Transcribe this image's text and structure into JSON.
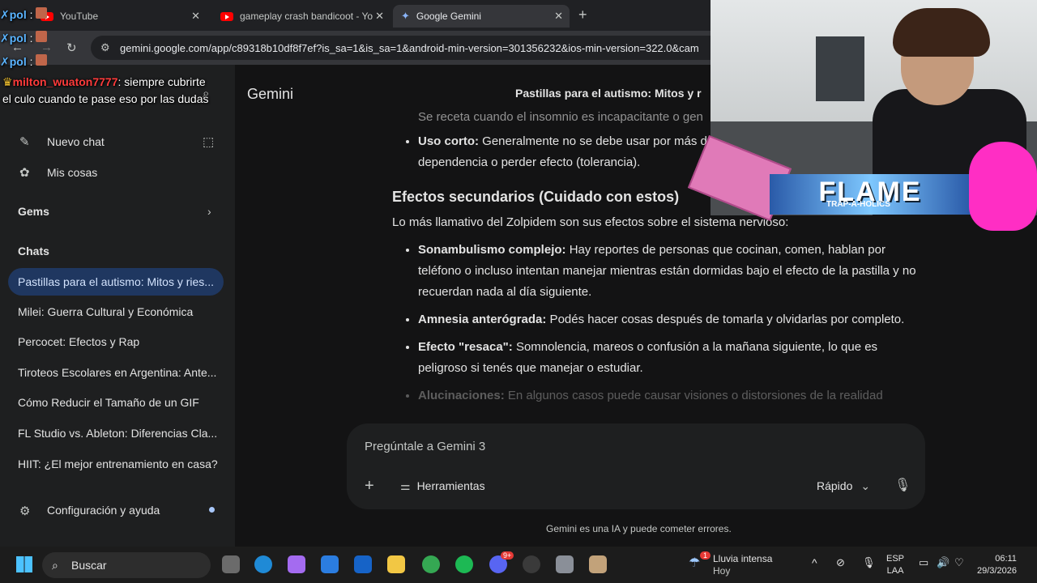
{
  "browser": {
    "tabs": [
      {
        "label": "YouTube"
      },
      {
        "label": "gameplay crash bandicoot - Yo"
      },
      {
        "label": "Google Gemini"
      }
    ],
    "url": "gemini.google.com/app/c89318b10df8f7ef?is_sa=1&is_sa=1&android-min-version=301356232&ios-min-version=322.0&cam"
  },
  "sidebar": {
    "new_chat": "Nuevo chat",
    "my_stuff": "Mis cosas",
    "gems": "Gems",
    "chats_heading": "Chats",
    "chats": [
      "Pastillas para el autismo: Mitos y ries...",
      "Milei: Guerra Cultural y Económica",
      "Percocet: Efectos y Rap",
      "Tiroteos Escolares en Argentina: Ante...",
      "Cómo Reducir el Tamaño de un GIF",
      "FL Studio vs. Ableton: Diferencias Cla...",
      "HIIT: ¿El mejor entrenamiento en casa?"
    ],
    "settings": "Configuración y ayuda"
  },
  "main": {
    "brand": "Gemini",
    "conversation_title": "Pastillas para el autismo: Mitos y r",
    "top_fragment": "Se receta cuando el insomnio es incapacitante o gen",
    "short_use_label": "Uso corto:",
    "short_use_text": " Generalmente no se debe usar por más d",
    "short_use_text2": "dependencia o perder efecto (tolerancia).",
    "section_heading": "Efectos secundarios (Cuidado con estos)",
    "intro": "Lo más llamativo del Zolpidem son sus efectos sobre el sistema nervioso:",
    "bullets": [
      {
        "label": "Sonambulismo complejo:",
        "text": " Hay reportes de personas que cocinan, comen, hablan por teléfono o incluso intentan manejar mientras están dormidas bajo el efecto de la pastilla y no recuerdan nada al día siguiente."
      },
      {
        "label": "Amnesia anterógrada:",
        "text": " Podés hacer cosas después de tomarla y olvidarlas por completo."
      },
      {
        "label": "Efecto \"resaca\":",
        "text": " Somnolencia, mareos o confusión a la mañana siguiente, lo que es peligroso si tenés que manejar o estudiar."
      },
      {
        "label": "Alucinaciones:",
        "text": " En algunos casos puede causar visiones o distorsiones de la realidad"
      }
    ]
  },
  "composer": {
    "placeholder": "Pregúntale a Gemini 3",
    "tools": "Herramientas",
    "mode": "Rápido"
  },
  "disclaimer": "Gemini es una IA y puede cometer errores.",
  "stream_overlay": {
    "chat_user_short": "pol",
    "chat_user": "milton_wuaton7777",
    "chat_message": ": siempre cubrirte el culo cuando te pase eso por las dudas",
    "banner": "FLAME",
    "banner_sub": "TRAP-A-HOLICS"
  },
  "taskbar": {
    "search": "Buscar",
    "weather_title": "Lluvia intensa",
    "weather_sub": "Hoy",
    "lang_top": "ESP",
    "lang_bottom": "LAA",
    "time": "06:11",
    "date": "29/3/2026",
    "notification_badge": "1",
    "discord_badge": "9+"
  }
}
